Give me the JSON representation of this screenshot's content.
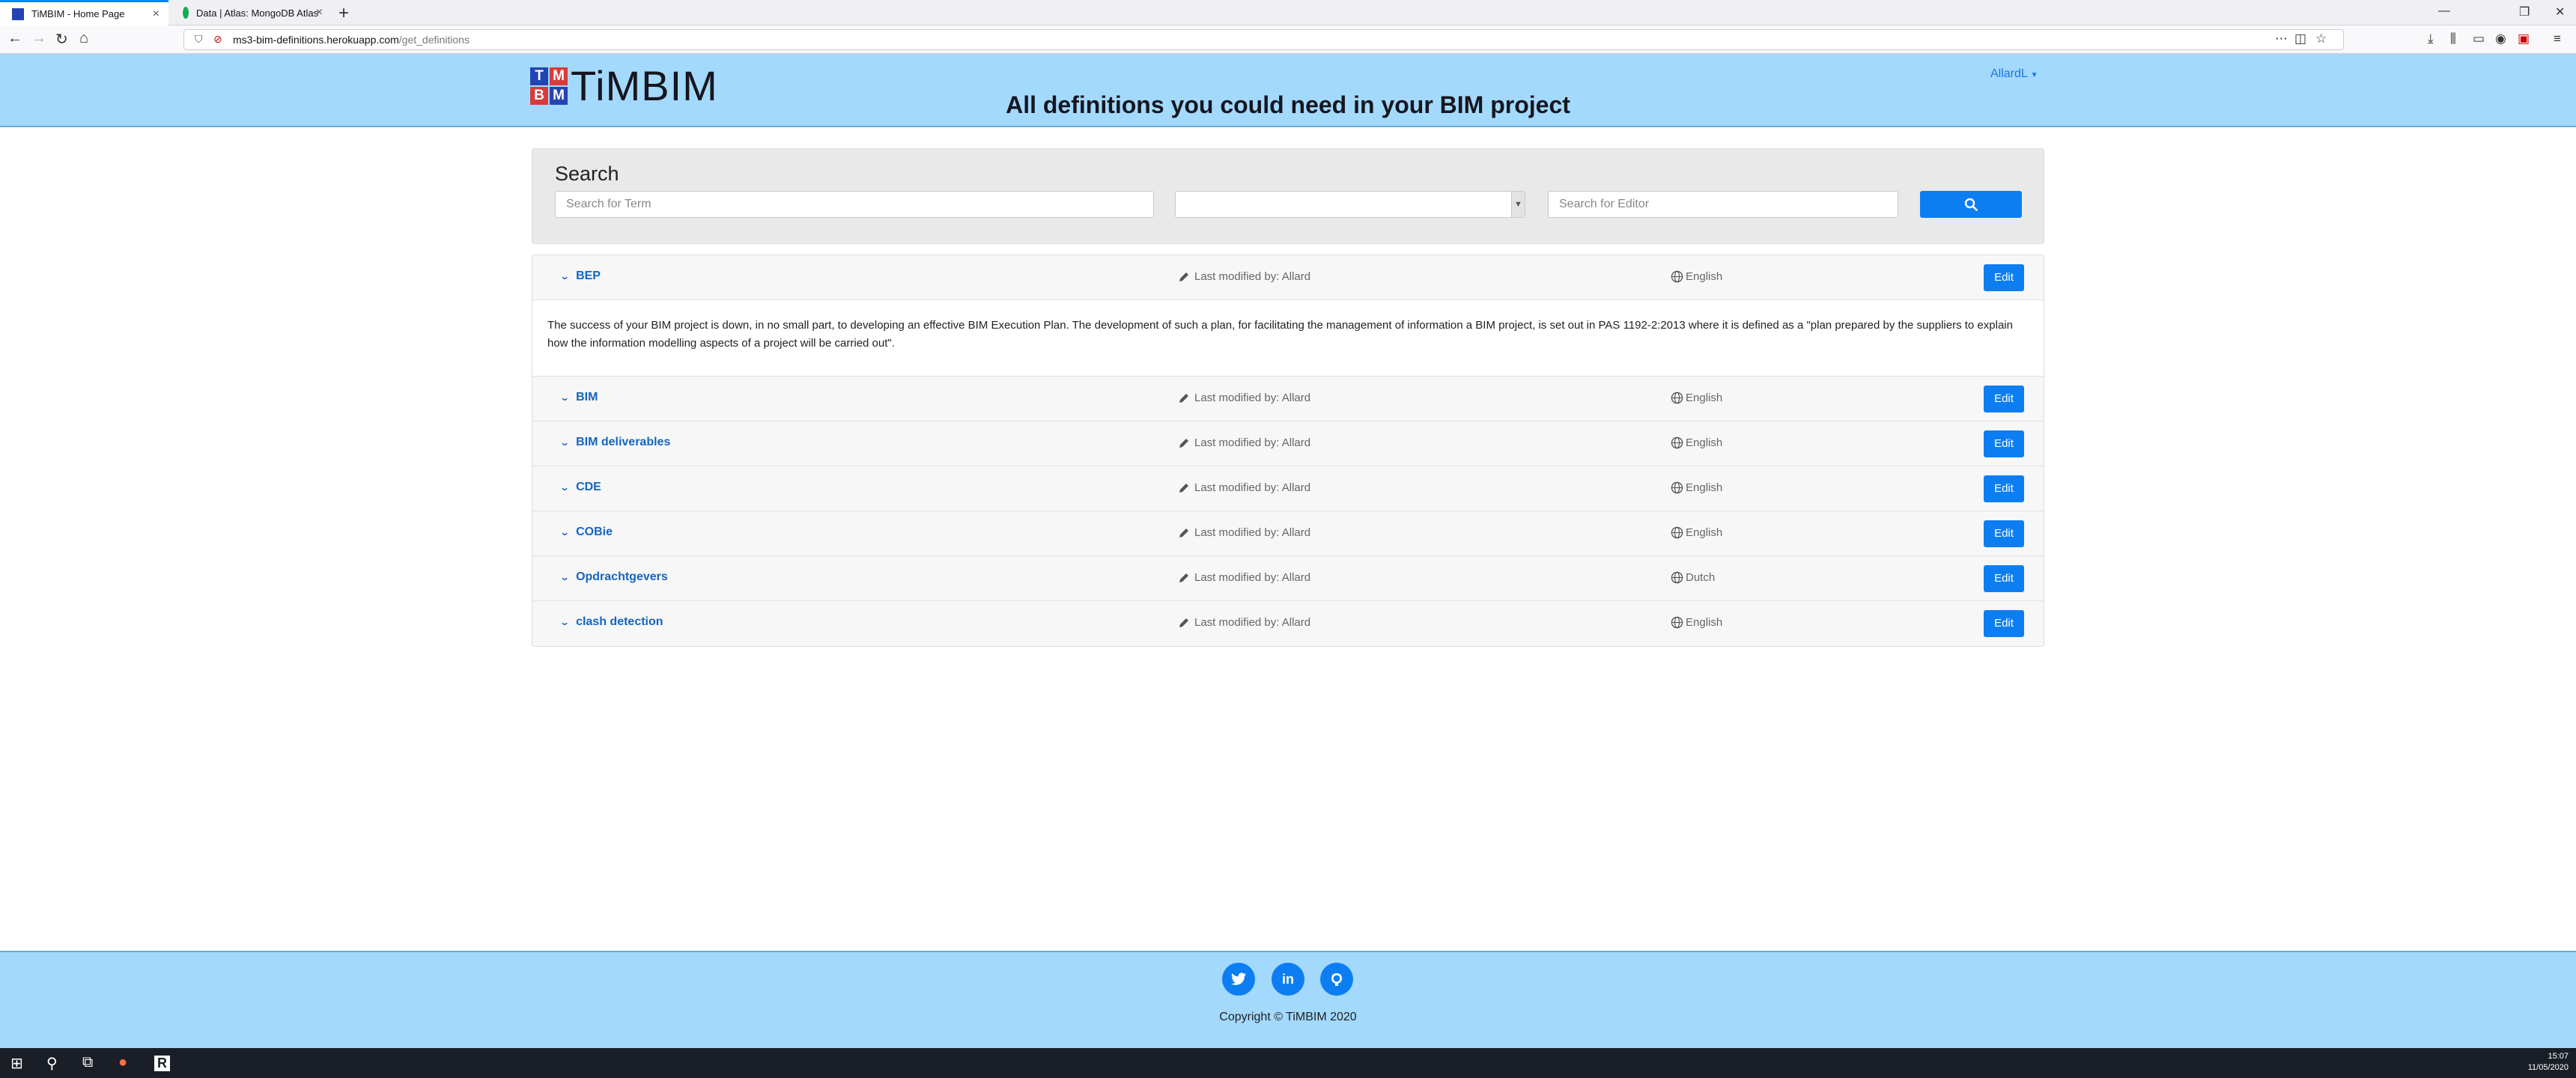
{
  "browser": {
    "tabs": [
      {
        "title": "TiMBIM - Home Page",
        "active": true
      },
      {
        "title": "Data | Atlas: MongoDB Atlas",
        "active": false
      }
    ],
    "url_domain": "ms3-bim-definitions.herokuapp.com",
    "url_path": "/get_definitions",
    "accent": "#0a84ff"
  },
  "header": {
    "logo_letters": [
      "T",
      "M",
      "B",
      "M"
    ],
    "logo_text": "TiMBIM",
    "tagline": "All definitions you could need in your BIM project",
    "user_menu": "AllardL",
    "background": "#a3d9fc"
  },
  "search": {
    "title": "Search",
    "term_placeholder": "Search for Term",
    "language_selected": "",
    "editor_placeholder": "Search for Editor",
    "button_icon": "search-icon",
    "button_color": "#0d7ef2"
  },
  "definitions": [
    {
      "term": "BEP",
      "modified": "Last modified by: Allard",
      "language": "English",
      "edit": "Edit",
      "expanded": true,
      "body": "The success of your BIM project is down, in no small part, to developing an effective BIM Execution Plan. The development of such a plan, for facilitating the management of information a BIM project, is set out in PAS 1192-2:2013 where it is defined as a \"plan prepared by the suppliers to explain how the information modelling aspects of a project will be carried out\"."
    },
    {
      "term": "BIM",
      "modified": "Last modified by: Allard",
      "language": "English",
      "edit": "Edit",
      "expanded": false
    },
    {
      "term": "BIM deliverables",
      "modified": "Last modified by: Allard",
      "language": "English",
      "edit": "Edit",
      "expanded": false
    },
    {
      "term": "CDE",
      "modified": "Last modified by: Allard",
      "language": "English",
      "edit": "Edit",
      "expanded": false
    },
    {
      "term": "COBie",
      "modified": "Last modified by: Allard",
      "language": "English",
      "edit": "Edit",
      "expanded": false
    },
    {
      "term": "Opdrachtgevers",
      "modified": "Last modified by: Allard",
      "language": "Dutch",
      "edit": "Edit",
      "expanded": false
    },
    {
      "term": "clash detection",
      "modified": "Last modified by: Allard",
      "language": "English",
      "edit": "Edit",
      "expanded": false
    }
  ],
  "footer": {
    "social": [
      {
        "icon": "twitter-icon",
        "glyph": "t"
      },
      {
        "icon": "linkedin-icon",
        "glyph": "in"
      },
      {
        "icon": "github-icon",
        "glyph": "gh"
      }
    ],
    "copyright": "Copyright © TiMBIM 2020"
  },
  "taskbar": {
    "time": "15:07",
    "date": "11/05/2020"
  }
}
